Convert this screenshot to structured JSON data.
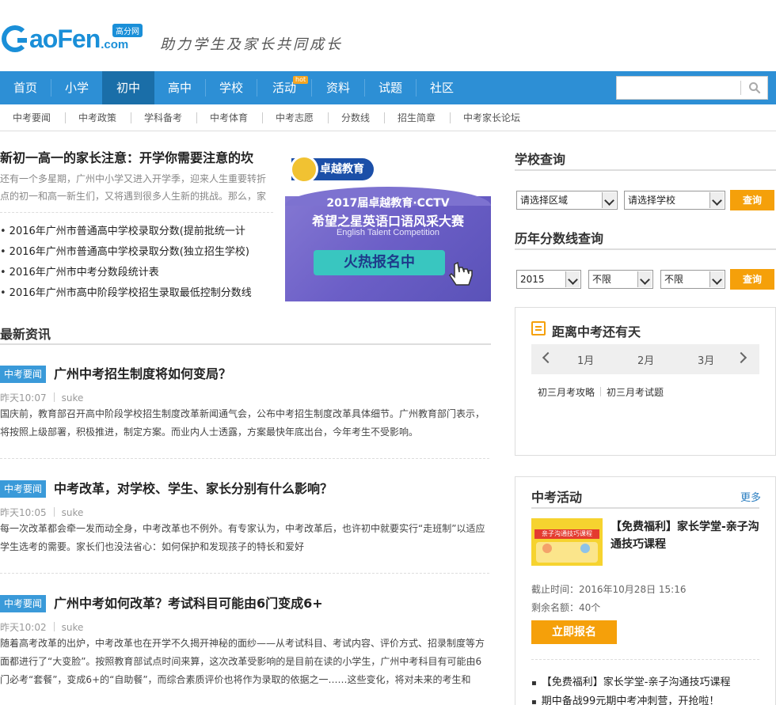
{
  "header": {
    "logo_main": "aoFen",
    "logo_com": ".com",
    "logo_badge": "高分网",
    "slogan": "助力学生及家长共同成长"
  },
  "nav": {
    "items": [
      {
        "label": "首页"
      },
      {
        "label": "小学"
      },
      {
        "label": "初中",
        "active": true
      },
      {
        "label": "高中"
      },
      {
        "label": "学校"
      },
      {
        "label": "活动",
        "badge": "hot"
      },
      {
        "label": "资料"
      },
      {
        "label": "试题"
      },
      {
        "label": "社区"
      }
    ],
    "search_placeholder": ""
  },
  "subnav": {
    "items": [
      "中考要闻",
      "中考政策",
      "学科备考",
      "中考体育",
      "中考志愿",
      "分数线",
      "招生简章",
      "中考家长论坛"
    ]
  },
  "top_story": {
    "title": "新初一高一的家长注意：开学你需要注意的坎",
    "summary": "还有一个多星期，广州中小学又进入开学季，迎来人生重要转折点的初一和高一新生们，又将遇到很多人生新的挑战。那么，家",
    "links": [
      "2016年广州市普通高中学校录取分数(提前批统一计",
      "2016年广州市普通高中学校录取分数(独立招生学校)",
      "2016年广州市中考分数段统计表",
      "2016年广州市高中阶段学校招生录取最低控制分数线"
    ]
  },
  "banner": {
    "org": "卓越教育",
    "title": "2017届卓越教育·CCTV",
    "subtitle": "希望之星英语口语风采大赛",
    "english": "English Talent Competition",
    "cta": "火热报名中"
  },
  "latest": {
    "heading": "最新资讯",
    "items": [
      {
        "tag": "中考要闻",
        "title": "广州中考招生制度将如何变局？",
        "time": "昨天10:07",
        "author": "suke",
        "body": "国庆前，教育部召开高中阶段学校招生制度改革新闻通气会，公布中考招生制度改革具体细节。广州教育部门表示，将按照上级部署，积极推进，制定方案。而业内人士透露，方案最快年底出台，今年考生不受影响。"
      },
      {
        "tag": "中考要闻",
        "title": "中考改革，对学校、学生、家长分别有什么影响？",
        "time": "昨天10:05",
        "author": "suke",
        "body": "每一次改革都会牵一发而动全身，中考改革也不例外。有专家认为，中考改革后，也许初中就要实行“走班制”以适应学生选考的需要。家长们也没法省心：如何保护和发现孩子的特长和爱好"
      },
      {
        "tag": "中考要闻",
        "title": "广州中考如何改革？考试科目可能由6门变成6+",
        "time": "昨天10:02",
        "author": "suke",
        "body": "随着高考改革的出炉，中考改革也在开学不久揭开神秘的面纱——从考试科目、考试内容、评价方式、招录制度等方面都进行了“大变脸”。按照教育部试点时间来算，这次改革受影响的是目前在读的小学生，广州中考科目有可能由6门必考“套餐”，变成6+的“自助餐”，而综合素质评价也将作为录取的依据之一……这些变化，将对未来的考生和"
      }
    ]
  },
  "school_query": {
    "heading": "学校查询",
    "region": "请选择区域",
    "school": "请选择学校",
    "button": "查询"
  },
  "score_query": {
    "heading": "历年分数线查询",
    "year": "2015",
    "opt1": "不限",
    "opt2": "不限",
    "button": "查询"
  },
  "countdown": {
    "heading": "距离中考还有天",
    "months": [
      "1月",
      "2月",
      "3月"
    ],
    "links": [
      "初三月考攻略",
      "初三月考试题"
    ]
  },
  "activity": {
    "heading": "中考活动",
    "more": "更多",
    "thumb_text": "亲子沟通技巧课程",
    "name": "【免费福利】家长学堂-亲子沟通技巧课程",
    "deadline": "截止时间：2016年10月28日 15:16",
    "remaining": "剩余名额：40个",
    "button": "立即报名",
    "list": [
      "【免费福利】家长学堂-亲子沟通技巧课程",
      "期中备战99元期中考冲刺营，开抢啦！"
    ]
  }
}
